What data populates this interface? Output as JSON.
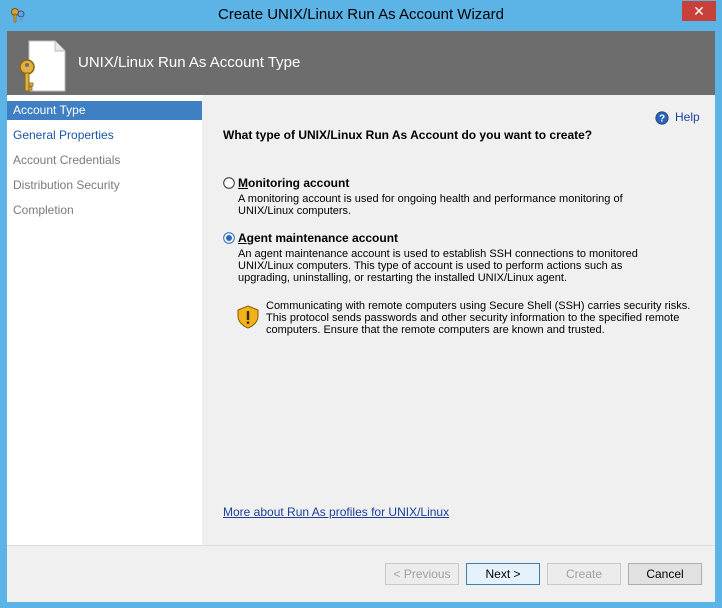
{
  "window": {
    "title": "Create UNIX/Linux Run As Account Wizard",
    "close_glyph": "✕"
  },
  "header": {
    "title": "UNIX/Linux Run As Account Type"
  },
  "nav": {
    "items": [
      {
        "label": "Account Type",
        "state": "selected"
      },
      {
        "label": "General Properties",
        "state": "link"
      },
      {
        "label": "Account Credentials",
        "state": "dim"
      },
      {
        "label": "Distribution Security",
        "state": "dim"
      },
      {
        "label": "Completion",
        "state": "dim"
      }
    ]
  },
  "content": {
    "help_label": "Help",
    "question": "What type of UNIX/Linux Run As Account do you want to create?",
    "options": [
      {
        "accel": "M",
        "label_rest": "onitoring account",
        "selected": false,
        "description": "A monitoring account is used for ongoing health and performance monitoring of UNIX/Linux computers."
      },
      {
        "accel": "A",
        "label_rest": "gent maintenance account",
        "selected": true,
        "description": "An agent maintenance account is used to establish SSH connections to monitored UNIX/Linux computers. This type of account is used to perform actions such as upgrading, uninstalling, or restarting the installed UNIX/Linux agent."
      }
    ],
    "warning": "Communicating with remote computers using Secure Shell (SSH) carries security risks. This protocol sends passwords and other security information to the specified remote computers. Ensure that the remote computers are known and trusted.",
    "more_link": "More about Run As profiles for UNIX/Linux"
  },
  "footer": {
    "previous": "< Previous",
    "next": "Next >",
    "create": "Create",
    "cancel": "Cancel"
  },
  "colors": {
    "titlebar": "#5bb3e6",
    "header": "#6d6d6d",
    "nav_selected": "#3f7fc4",
    "link": "#1c3f9b"
  }
}
